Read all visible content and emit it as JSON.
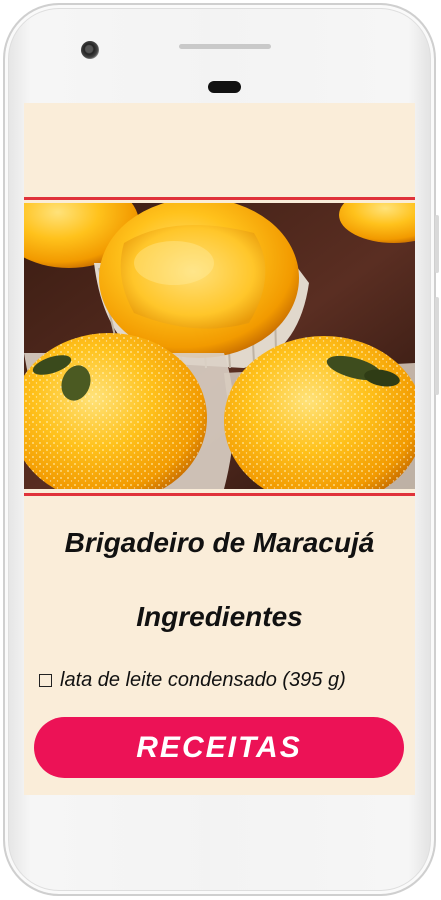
{
  "recipe": {
    "title": "Brigadeiro de Maracujá",
    "section_heading": "Ingredientes",
    "ingredients": [
      {
        "text": "lata de leite condensado (395 g)",
        "checked": false
      }
    ]
  },
  "actions": {
    "primary_label": "RECEITAS"
  },
  "image": {
    "subject": "brigadeiros de maracujá"
  },
  "colors": {
    "screen_background": "#faedd9",
    "divider_red": "#e0323a",
    "button_pink": "#ec1256"
  }
}
